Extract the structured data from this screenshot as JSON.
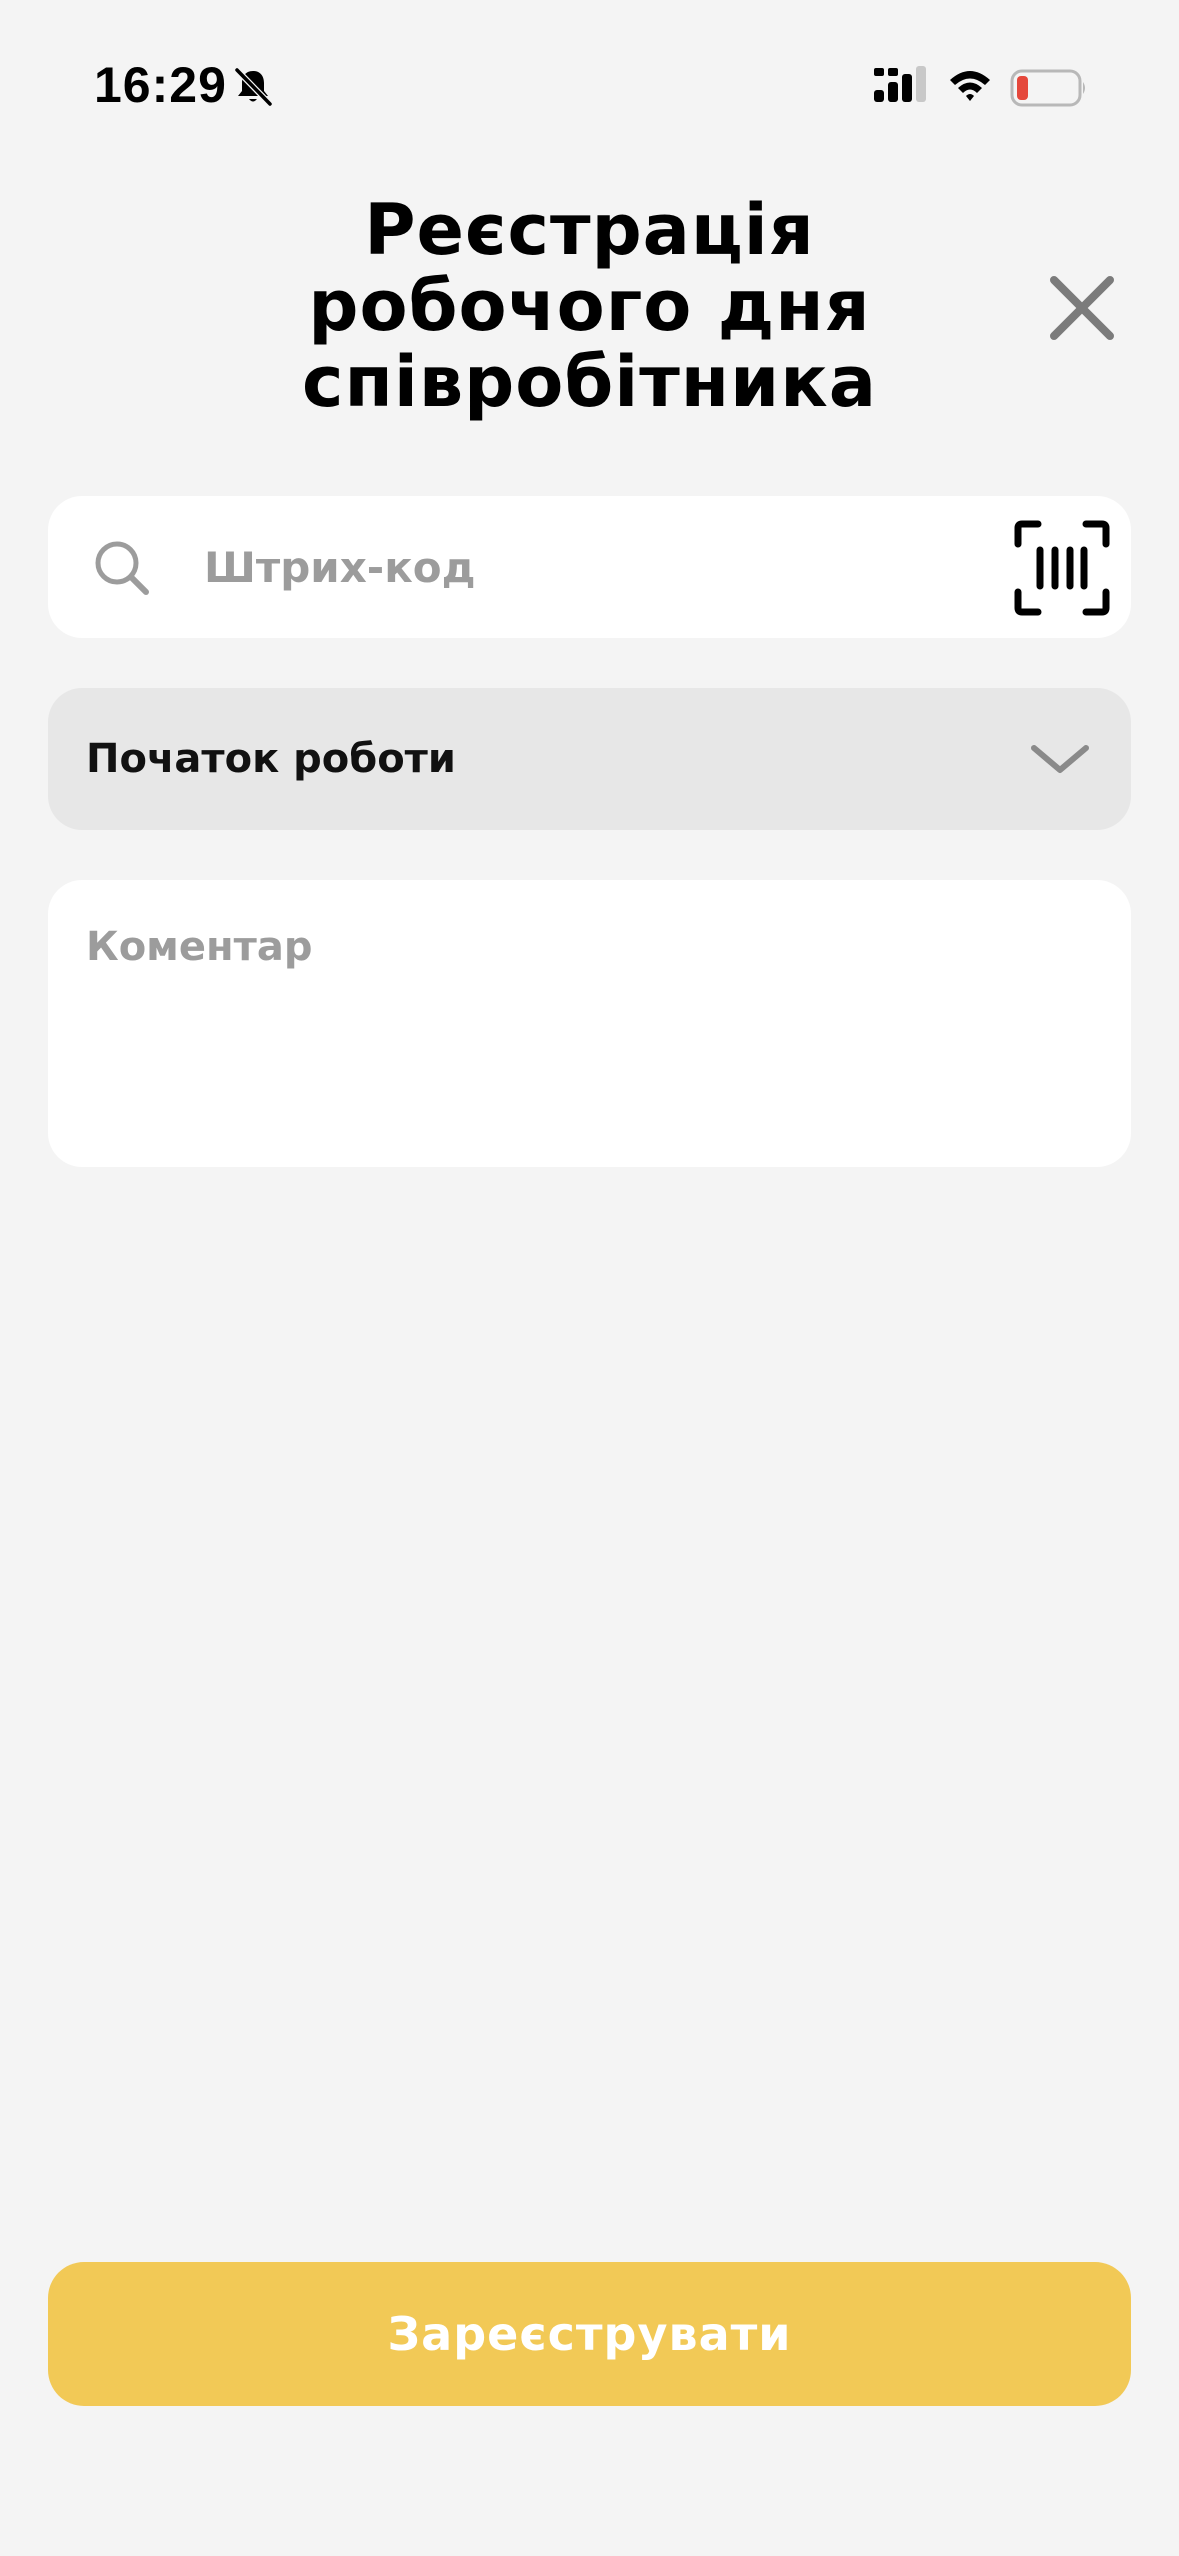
{
  "status_bar": {
    "time": "16:29",
    "icons": [
      "bell-off-icon",
      "signal-icon",
      "wifi-icon",
      "battery-icon"
    ],
    "battery_color": "#e5483c"
  },
  "header": {
    "title_lines": [
      "Реєстрація",
      "робочого дня",
      "співробітника"
    ],
    "close_icon": "close-icon"
  },
  "barcode": {
    "placeholder": "Штрих-код",
    "value": "",
    "search_icon": "search-icon",
    "scan_icon": "barcode-scan-icon"
  },
  "work_type": {
    "selected": "Початок роботи",
    "icon": "chevron-down-icon"
  },
  "comment": {
    "placeholder": "Коментар",
    "value": ""
  },
  "submit": {
    "label": "Зареєструвати"
  },
  "colors": {
    "background": "#f4f4f4",
    "field_background": "#ffffff",
    "select_background": "#e7e7e7",
    "accent": "#f2c956",
    "placeholder": "#9c9c9c",
    "icon_gray": "#7b7b7b"
  }
}
